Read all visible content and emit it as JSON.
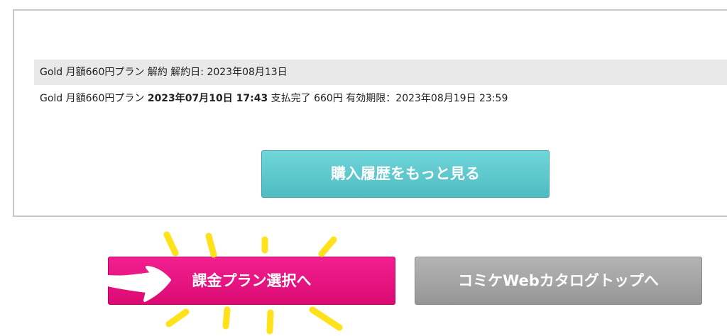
{
  "history": {
    "rows": [
      {
        "plan": "Gold 月額660円プラン",
        "action": "解約",
        "date_label": "解約日: 2023年08月13日"
      },
      {
        "plan": "Gold 月額660円プラン",
        "datetime": "2023年07月10日 17:43",
        "status": "支払完了",
        "amount": "660円",
        "expiry": "有効期限：2023年08月19日 23:59"
      }
    ],
    "more_button_label": "購入履歴をもっと見る"
  },
  "actions": {
    "plan_select_label": "課金プラン選択へ",
    "catalog_top_label": "コミケWebカタログトップへ"
  },
  "colors": {
    "accent_teal": "#5cc7cb",
    "accent_pink": "#e8127f",
    "neutral_gray": "#a6a6a6",
    "annotation_yellow": "#ffe11c"
  },
  "annotations": {
    "icons": [
      "pointing-arrow-icon",
      "highlight-burst-icon"
    ]
  }
}
